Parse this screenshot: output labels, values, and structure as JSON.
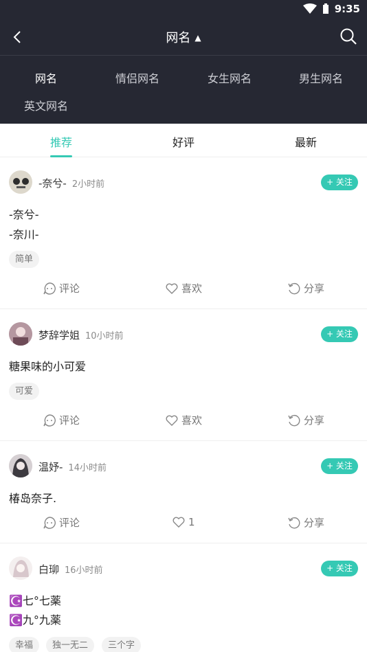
{
  "status": {
    "time": "9:35"
  },
  "header": {
    "title": "网名"
  },
  "categories": [
    "网名",
    "情侣网名",
    "女生网名",
    "男生网名",
    "英文网名"
  ],
  "tabs": [
    "推荐",
    "好评",
    "最新"
  ],
  "follow_label": "+ 关注",
  "posts": [
    {
      "user": "-奈兮-",
      "time": "2小时前",
      "lines": [
        "-奈兮-",
        "-奈川-"
      ],
      "tags": [
        "简单"
      ],
      "comment": "评论",
      "like": "喜欢",
      "share": "分享"
    },
    {
      "user": "梦辞学姐",
      "time": "10小时前",
      "lines": [
        "糖果味的小可爱"
      ],
      "tags": [
        "可爱"
      ],
      "comment": "评论",
      "like": "喜欢",
      "share": "分享"
    },
    {
      "user": "温妤-",
      "time": "14小时前",
      "lines": [
        "椿岛奈子."
      ],
      "tags": [],
      "comment": "评论",
      "like": "1",
      "share": "分享"
    },
    {
      "user": "白珋",
      "time": "16小时前",
      "lines": [
        "☪️七°七薬",
        "☪️九°九薬"
      ],
      "tags": [
        "幸福",
        "独一无二",
        "三个字"
      ]
    }
  ],
  "colors": {
    "header_bg": "#262833",
    "accent": "#35c9b4"
  }
}
